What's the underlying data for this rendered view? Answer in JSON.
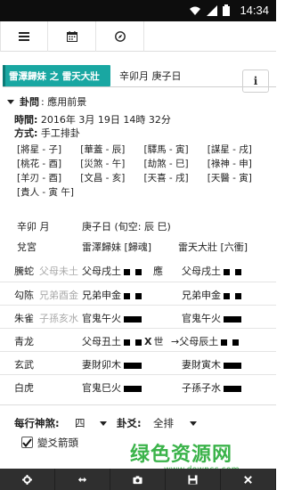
{
  "status_bar": {
    "time": "14:34",
    "icons": [
      "wifi-icon",
      "signal-icon",
      "battery-icon"
    ]
  },
  "toolbar": {
    "items": [
      {
        "name": "menu-icon"
      },
      {
        "name": "calendar-icon"
      },
      {
        "name": "compass-icon"
      }
    ]
  },
  "tabs": {
    "active_label": "雷澤歸妹 之 雷天大壯",
    "inactive_label": "辛卯月 庚子日",
    "info_label": "i"
  },
  "hexagram": {
    "section_label": "卦問",
    "section_value": "應用前景",
    "time_label": "時間",
    "time_value": "2016年 3月 19日 14時 32分",
    "method_label": "方式",
    "method_value": "手工排卦"
  },
  "gods": [
    [
      "[將星 - 子]",
      "[華蓋 - 辰]",
      "[驛馬 - 寅]",
      "[謀星 - 戌]"
    ],
    [
      "[桃花 - 酉]",
      "[災煞 - 午]",
      "[劫煞 - 巳]",
      "[祿神 - 申]"
    ],
    [
      "[羊刃 - 酉]",
      "[文昌 - 亥]",
      "[天喜 - 戌]",
      "[天醫 - 寅]"
    ],
    [
      "[貴人 - 寅 午]"
    ]
  ],
  "table": {
    "month": "辛卯 月",
    "day": "庚子日 (旬空: 辰 巳)",
    "palace_label": "兌宮",
    "main_gua": "雷澤歸妹 [歸魂]",
    "changed_gua": "雷天大壯 [六衝]",
    "rows": [
      {
        "spirit": "騰蛇",
        "hidden": "父母未土",
        "main": "父母戌土",
        "line": "yin",
        "mark": "",
        "shi": "應",
        "changed": "父母戌土",
        "cline": "yin"
      },
      {
        "spirit": "勾陈",
        "hidden": "兄弟酉金",
        "main": "兄弟申金",
        "line": "yin",
        "mark": "",
        "shi": "",
        "changed": "兄弟申金",
        "cline": "yin"
      },
      {
        "spirit": "朱雀",
        "hidden": "子孫亥水",
        "main": "官鬼午火",
        "line": "yang",
        "mark": "",
        "shi": "",
        "changed": "官鬼午火",
        "cline": "yang"
      },
      {
        "spirit": "青龙",
        "hidden": "",
        "main": "父母丑土",
        "line": "yin",
        "mark": "X",
        "shi": "世",
        "changed": "→父母辰土",
        "cline": "yin"
      },
      {
        "spirit": "玄武",
        "hidden": "",
        "main": "妻財卯木",
        "line": "yang",
        "mark": "",
        "shi": "",
        "changed": "妻財寅木",
        "cline": "yang"
      },
      {
        "spirit": "白虎",
        "hidden": "",
        "main": "官鬼巳火",
        "line": "yang",
        "mark": "",
        "shi": "",
        "changed": "子孫子水",
        "cline": "yang"
      }
    ]
  },
  "controls": {
    "spirit_label": "每行神煞:",
    "spirit_value": "四",
    "gua_yao_label": "卦爻:",
    "gua_yao_value": "全排",
    "checkbox_label": "變爻箭頭",
    "checkbox_checked": true
  },
  "bottom_bar": [
    "gear-icon",
    "swap-icon",
    "camera-icon",
    "save-icon",
    "close-icon"
  ],
  "watermark": {
    "title": "绿色资源网",
    "url": "www.downcc.com"
  },
  "colors": {
    "accent": "#19a7a2",
    "watermark_green": "#3bb34a",
    "bottom_bar": "#2f2f2f",
    "status_bar": "#0d0d0d"
  }
}
